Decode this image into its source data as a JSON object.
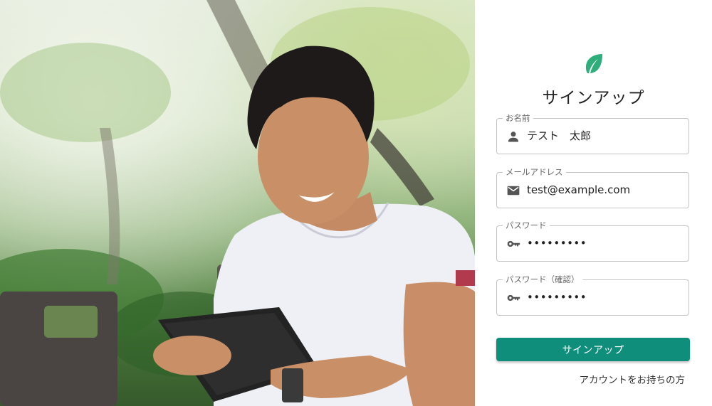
{
  "hero": {
    "image": "man-smiling-using-tablet-photo"
  },
  "logo": {
    "icon": "leaf-icon",
    "color": "#2eae7a"
  },
  "title": "サインアップ",
  "fields": [
    {
      "label": "お名前",
      "icon": "person-icon",
      "value": "テスト　太郎"
    },
    {
      "label": "メールアドレス",
      "icon": "mail-icon",
      "value": "test@example.com"
    },
    {
      "label": "パスワード",
      "icon": "key-icon",
      "value": "•••••••••"
    },
    {
      "label": "パスワード（確認）",
      "icon": "key-icon",
      "value": "•••••••••"
    }
  ],
  "submit_label": "サインアップ",
  "login_link": "アカウントをお持ちの方",
  "colors": {
    "accent": "#0f8e7b"
  }
}
